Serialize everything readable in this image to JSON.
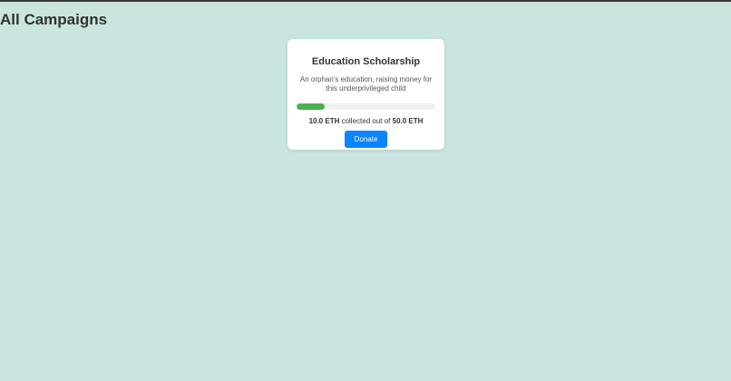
{
  "header": {
    "title": "All Campaigns"
  },
  "campaigns": [
    {
      "title": "Education Scholarship",
      "description": "An orphan's education, raising money for this underprivileged child",
      "progress_fraction": 0.2,
      "collected": "10.0 ETH",
      "collected_mid": " collected out of ",
      "goal": "50.0 ETH",
      "donate_label": "Donate"
    }
  ],
  "colors": {
    "background": "#cae5df",
    "progress": "#4caf50",
    "button": "#0a84ff"
  }
}
